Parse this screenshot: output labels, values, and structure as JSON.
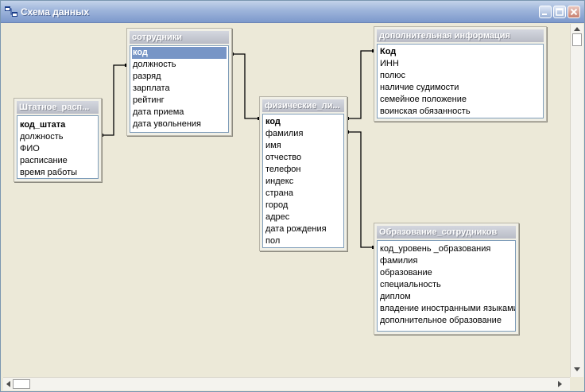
{
  "window": {
    "title": "Схема данных"
  },
  "tables": {
    "staff_schedule": {
      "title": "Штатное_расп...",
      "fields": [
        "код_штата",
        "должность",
        "ФИО",
        "расписание",
        "время работы"
      ]
    },
    "employees": {
      "title": "сотрудники",
      "fields": [
        "код",
        "должность",
        "разряд",
        "зарплата",
        "рейтинг",
        "дата приема",
        "дата увольнения"
      ]
    },
    "persons": {
      "title": "физические_ли...",
      "fields": [
        "код",
        "фамилия",
        "имя",
        "отчество",
        "телефон",
        "индекс",
        "страна",
        "город",
        "адрес",
        "дата рождения",
        "пол"
      ]
    },
    "extra_info": {
      "title": "дополнительная информация",
      "fields": [
        "Код",
        "ИНН",
        "полюс",
        "наличие судимости",
        "семейное положение",
        "воинская обязанность"
      ]
    },
    "education": {
      "title": "Образование_сотрудников",
      "fields": [
        "код_уровень _образования",
        "фамилия",
        "образование",
        "специальность",
        "диплом",
        "владение иностранными языками",
        "дополнительное образование"
      ]
    }
  },
  "colors": {
    "title_gradient_top": "#c4d3ea",
    "title_gradient_bottom": "#7d99cc",
    "selection": "#7795c6",
    "canvas": "#ece9d8"
  }
}
